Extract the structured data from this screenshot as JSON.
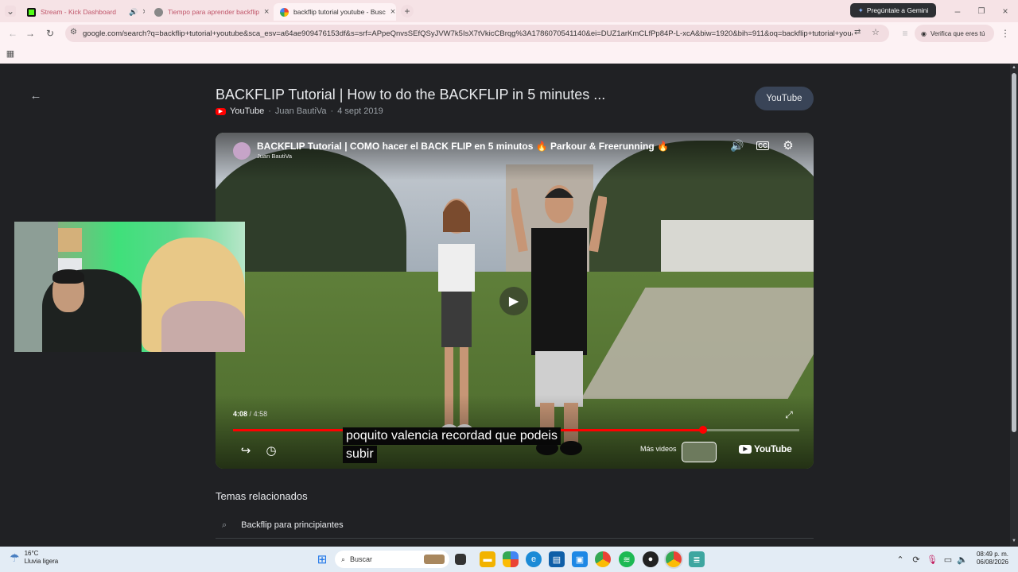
{
  "browser": {
    "tabs": [
      {
        "label": "Stream - Kick Dashboard",
        "favicon_color": "#111111",
        "active": false
      },
      {
        "label": "Tiempo para aprender backflip",
        "favicon_color": "#666666",
        "active": false
      },
      {
        "label": "backflip tutorial youtube - Busc",
        "favicon_color": "#4285f4",
        "active": true
      }
    ],
    "gemini_button": "Pregúntale a Gemini",
    "url": "google.com/search?q=backflip+tutorial+youtube&sca_esv=a64ae909476153df&s=srf=APpeQnvsSEfQSyJVW7k5IsX7tVkicCBrqg%3A1786070541140&ei=DUZ1arKmCLfPp84P-L-xcA&biw=1920&bih=911&oq=backflip+tutorial+you&...",
    "profile_label": "Verifica que eres tú"
  },
  "result": {
    "title": "BACKFLIP Tutorial | How to do the BACKFLIP in 5 minutes ...",
    "source": "YouTube",
    "channel": "Juan BautiVa",
    "date": "4 sept 2019",
    "open_button": "YouTube"
  },
  "video": {
    "title": "BACKFLIP Tutorial | COMO hacer el BACK FLIP en 5 minutos 🔥 Parkour & Freerunning 🔥",
    "channel": "Juan BautiVa",
    "current_time": "4:08",
    "separator": "/",
    "duration": "4:58",
    "progress": 0.83,
    "caption_line1": "poquito valencia recordad que podeis",
    "caption_line2": "subir",
    "more_videos": "Más videos",
    "logo_text": "YouTube"
  },
  "related": {
    "heading": "Temas relacionados",
    "query": "Backflip para principiantes"
  },
  "taskbar": {
    "temperature": "16°C",
    "weather": "Lluvia ligera",
    "search": "Buscar",
    "time": "08:49 p. m.",
    "date": "06/08/2026"
  }
}
